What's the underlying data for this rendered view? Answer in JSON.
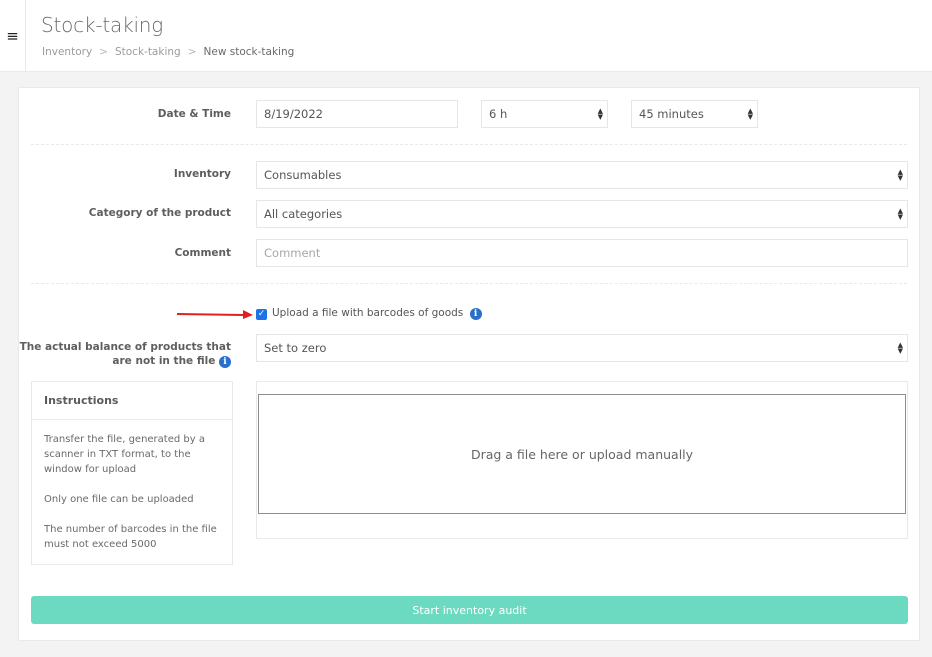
{
  "header": {
    "menu_icon": "hamburger-icon",
    "title": "Stock-taking",
    "breadcrumb": [
      "Inventory",
      "Stock-taking",
      "New stock-taking"
    ],
    "breadcrumb_sep": ">"
  },
  "form": {
    "datetime": {
      "label": "Date & Time",
      "date": "8/19/2022",
      "hour": "6 h",
      "minutes": "45 minutes"
    },
    "inventory": {
      "label": "Inventory",
      "value": "Consumables"
    },
    "category": {
      "label": "Category of the product",
      "value": "All categories"
    },
    "comment": {
      "label": "Comment",
      "placeholder": "Comment"
    },
    "upload_checkbox": {
      "label": "Upload a file with barcodes of goods",
      "checked": true
    },
    "balance": {
      "label_line1": "The actual balance of products that",
      "label_line2": "are not in the file",
      "value": "Set to zero"
    }
  },
  "instructions": {
    "title": "Instructions",
    "items": [
      "Transfer the file, generated by a scanner in TXT format, to the window for upload",
      "Only one file can be uploaded",
      "The number of barcodes in the file must not exceed 5000"
    ]
  },
  "upload": {
    "dropzone_text": "Drag a file here or upload manually"
  },
  "start_button": {
    "label": "Start inventory audit"
  },
  "colors": {
    "accent_button": "#6cdac0",
    "annotation_arrow": "#e02020",
    "info_icon": "#2a6fc9"
  }
}
